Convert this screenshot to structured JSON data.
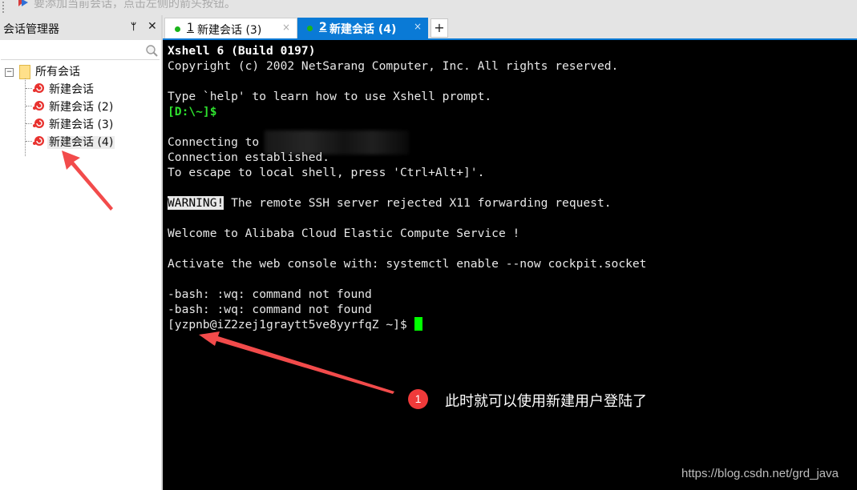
{
  "toolbar": {
    "hint_icon": "add-session-arrow-icon",
    "hint_text": "要添加当前会话，点击左侧的箭头按钮。"
  },
  "session_manager": {
    "title": "会话管理器",
    "pin_icon": "pin-icon",
    "close_icon": "close-icon",
    "search_placeholder": "",
    "root": {
      "label": "所有会话",
      "expander": "−"
    },
    "sessions": [
      {
        "label": "新建会话",
        "selected": false
      },
      {
        "label": "新建会话 (2)",
        "selected": false
      },
      {
        "label": "新建会话 (3)",
        "selected": false
      },
      {
        "label": "新建会话 (4)",
        "selected": true
      }
    ]
  },
  "tabs": [
    {
      "number": "1",
      "label": "新建会话 (3)",
      "active": false,
      "status_color": "#1bb41b",
      "close": "×"
    },
    {
      "number": "2",
      "label": "新建会话 (4)",
      "active": true,
      "status_color": "#1bb41b",
      "close": "×"
    }
  ],
  "add_tab_label": "+",
  "terminal": {
    "lines": [
      "Xshell 6 (Build 0197)",
      "Copyright (c) 2002 NetSarang Computer, Inc. All rights reserved.",
      "",
      "Type `help' to learn how to use Xshell prompt.",
      "[D:\\~]$",
      "",
      "Connecting to ",
      "Connection established.",
      "To escape to local shell, press 'Ctrl+Alt+]'.",
      "",
      "WARNING!",
      "",
      "Welcome to Alibaba Cloud Elastic Compute Service !",
      "",
      "Activate the web console with: systemctl enable --now cockpit.socket",
      "",
      "-bash: :wq: command not found",
      "-bash: :wq: command not found",
      "[yzpnb@iZ2zej1graytt5ve8yyrfqZ ~]$ "
    ],
    "warning_rest": " The remote SSH server rejected X11 forwarding request.",
    "cursor_color": "#00ff00",
    "prompt_color": "#2ee02e",
    "accent_color": "#0a7ad6"
  },
  "annotation": {
    "badge": "1",
    "text": "此时就可以使用新建用户登陆了",
    "color": "#f03a3a"
  },
  "watermark": "https://blog.csdn.net/grd_java"
}
